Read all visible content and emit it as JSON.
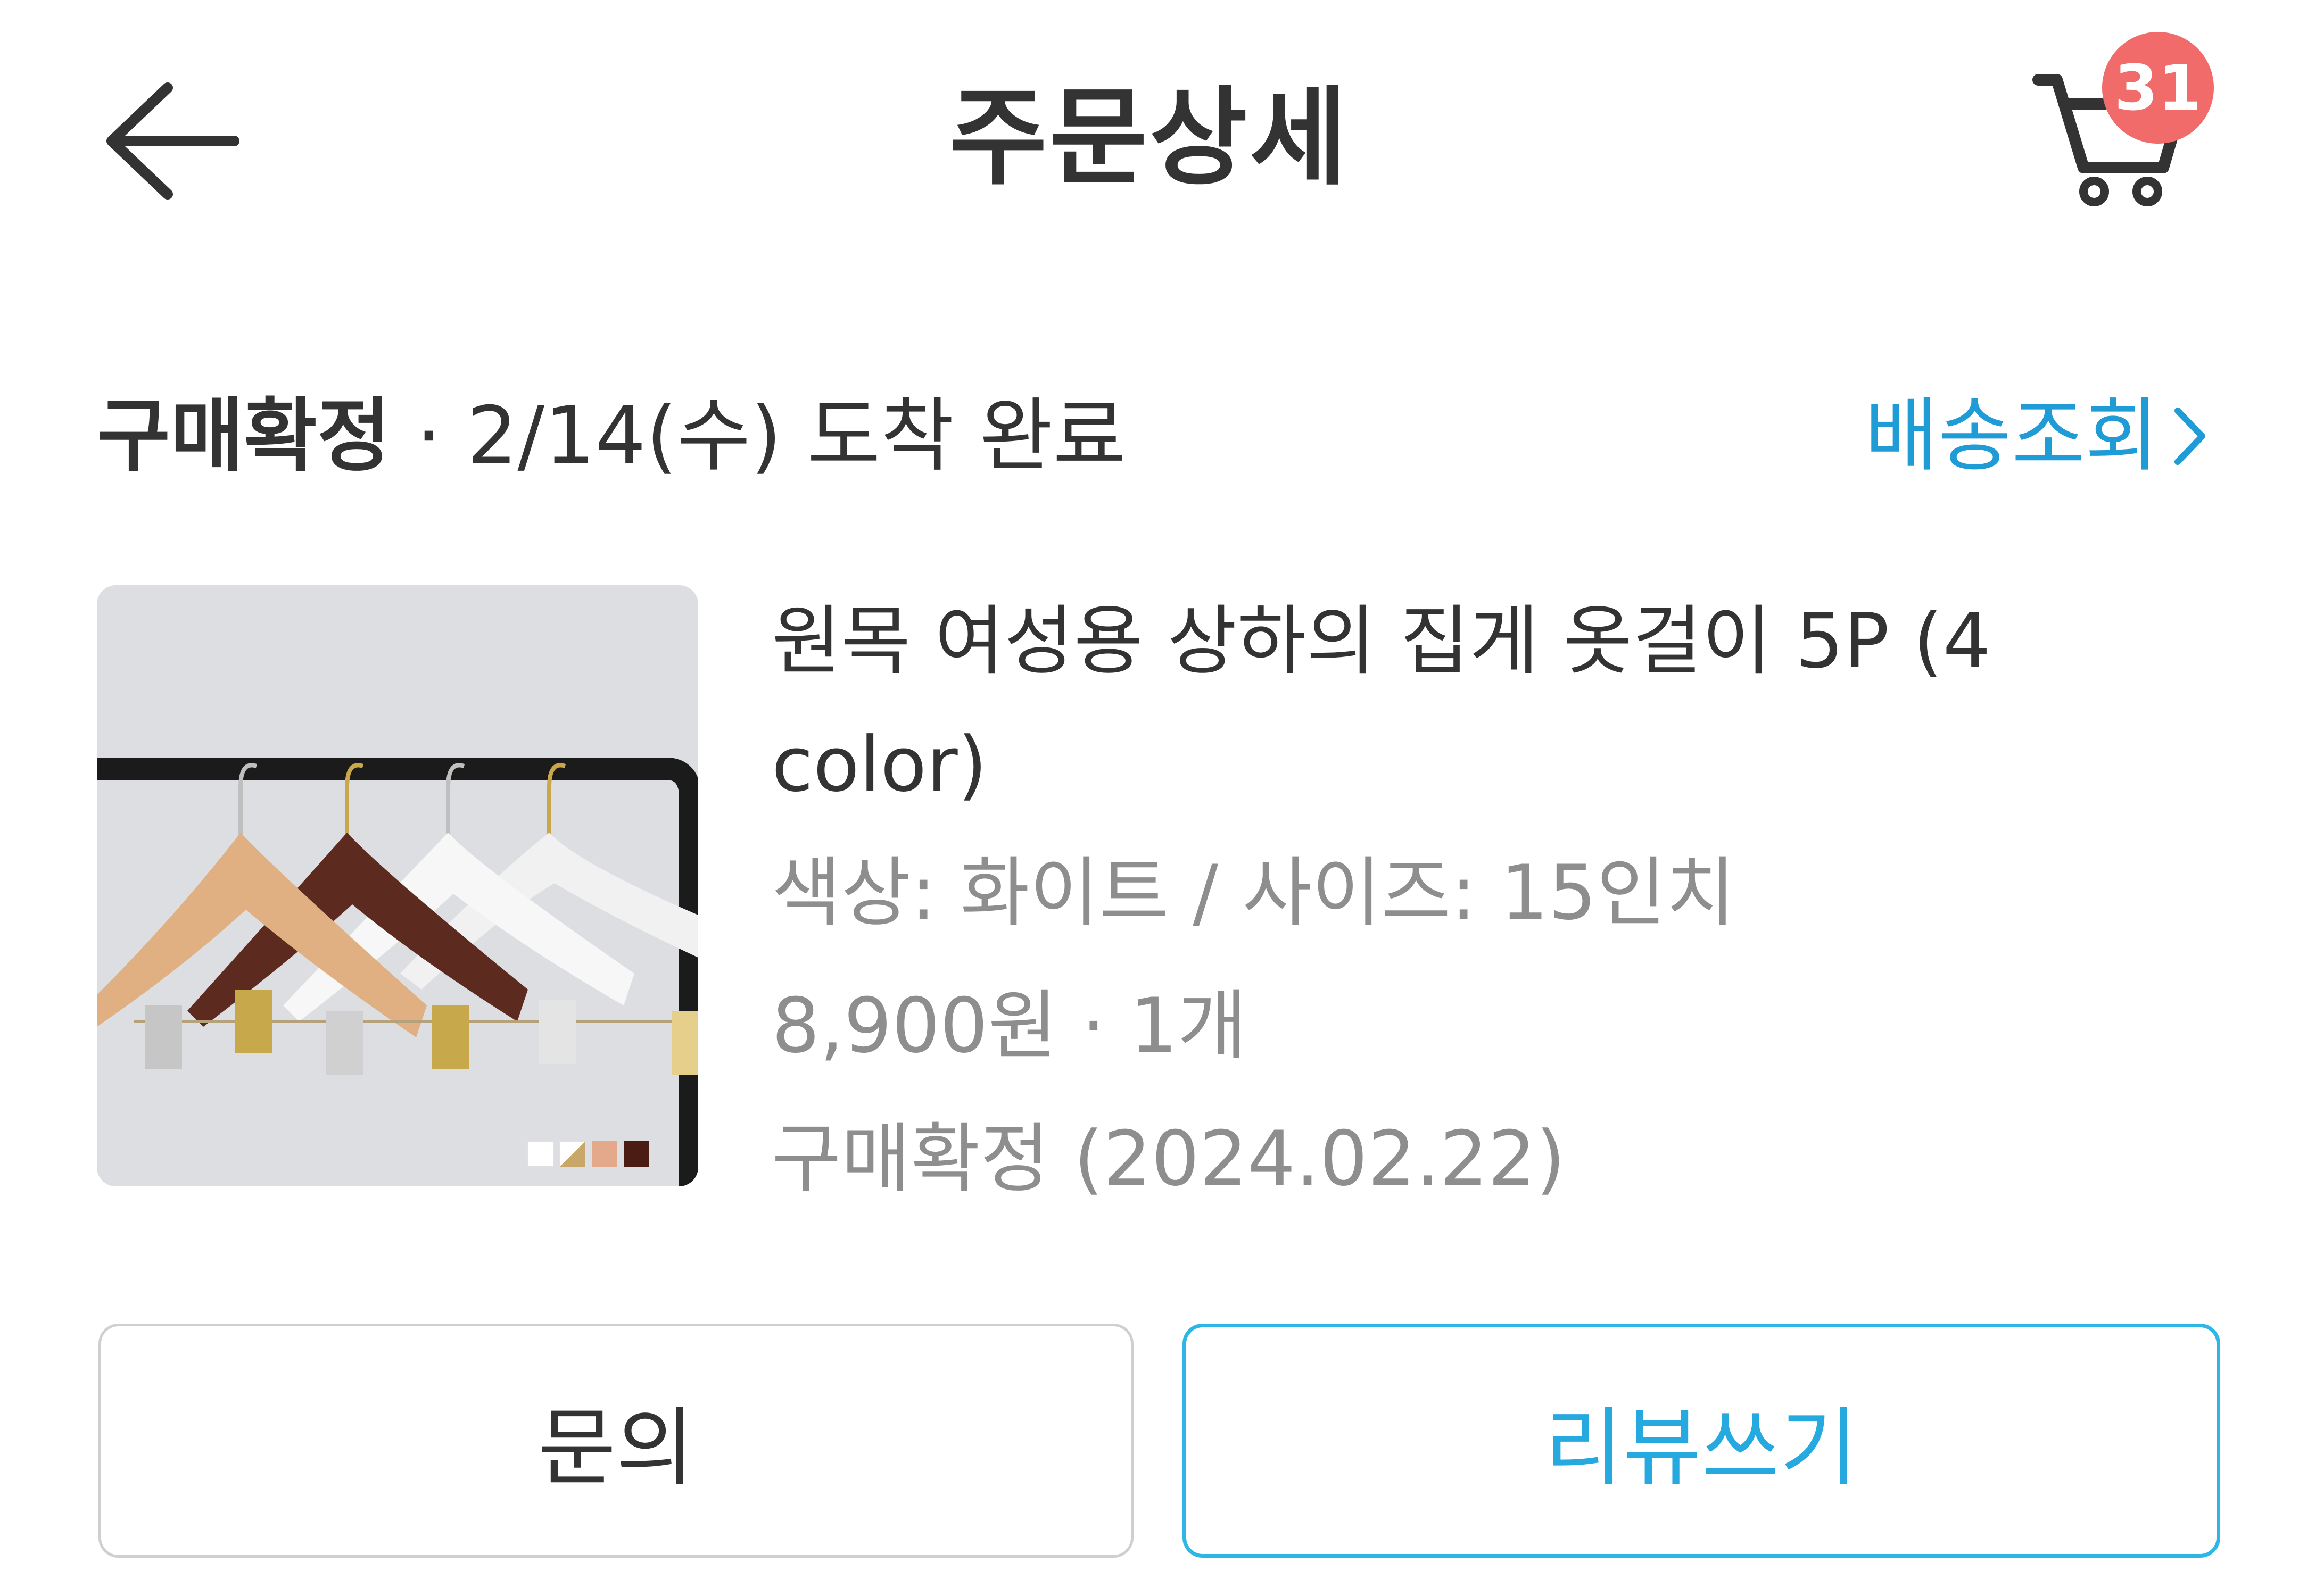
{
  "header": {
    "title": "주문상세",
    "back_icon": "arrow-left-icon",
    "cart_icon": "cart-icon",
    "cart_badge_count": "31"
  },
  "order_status": {
    "status": "구매확정",
    "separator": " · ",
    "arrival_text": "2/14(수) 도착 완료",
    "tracking_link_label": "배송조회",
    "tracking_icon": "chevron-right-icon"
  },
  "product": {
    "name": "원목 여성용 상하의 집게 옷걸이 5P (4 color)",
    "option": "색상: 화이트 / 사이즈: 15인치",
    "price_qty": "8,900원 · 1개",
    "confirmed": "구매확정 (2024.02.22)",
    "swatches": [
      "#ffffff",
      "#e9dcc4",
      "#e4a98a",
      "#4a1c14"
    ]
  },
  "actions": {
    "inquiry_label": "문의",
    "review_label": "리뷰쓰기"
  },
  "colors": {
    "accent": "#1f9bd6",
    "badge": "#f26b6b",
    "muted_text": "#8e8e8e"
  }
}
